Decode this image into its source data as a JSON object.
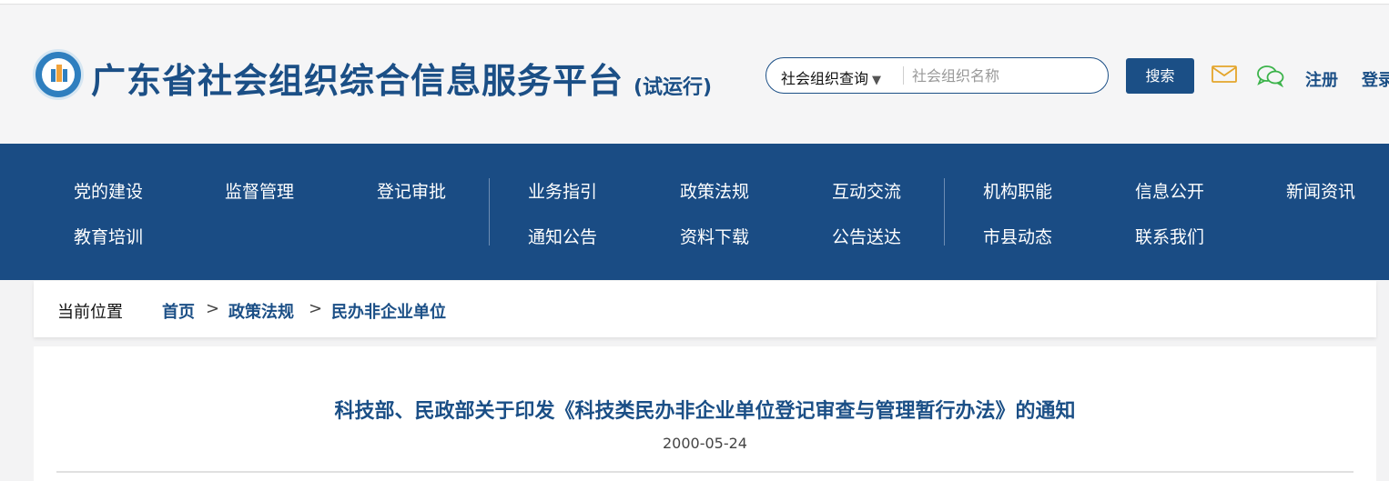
{
  "header": {
    "site_title": "广东省社会组织综合信息服务平台",
    "site_subtitle": "(试运行)",
    "search": {
      "type_selected": "社会组织查询",
      "placeholder": "社会组织名称",
      "button_label": "搜索"
    },
    "icons": [
      "mail-icon",
      "wechat-icon"
    ],
    "register_label": "注册",
    "login_label": "登录"
  },
  "nav": {
    "row1": [
      "党的建设",
      "监督管理",
      "登记审批",
      "业务指引",
      "政策法规",
      "互动交流",
      "机构职能",
      "信息公开",
      "新闻资讯"
    ],
    "row2": [
      "教育培训",
      "通知公告",
      "资料下载",
      "公告送达",
      "市县动态",
      "联系我们"
    ]
  },
  "breadcrumb": {
    "label": "当前位置",
    "items": [
      "首页",
      "政策法规",
      "民办非企业单位"
    ],
    "separator": ">"
  },
  "article": {
    "title": "科技部、民政部关于印发《科技类民办非企业单位登记审查与管理暂行办法》的通知",
    "date": "2000-05-24"
  },
  "colors": {
    "brand_blue": "#1b4f86",
    "nav_bg": "#1a4c84",
    "mail_icon": "#e4a52b",
    "wechat_icon": "#3bb34a"
  }
}
